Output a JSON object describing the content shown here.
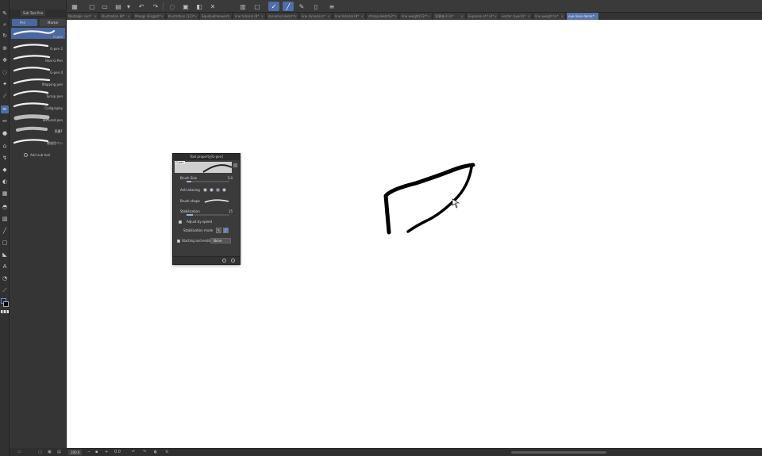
{
  "toolbar": {
    "icons": [
      "menu-icon",
      "new-file-icon",
      "open-icon",
      "save-icon",
      "dropdown-icon",
      "undo-icon",
      "redo-icon",
      "lasso-icon",
      "transform-icon",
      "fill-icon",
      "clear-icon",
      "pen-mode-icon",
      "line-mode-icon",
      "edit-icon",
      "layer-icon",
      "document-icon"
    ]
  },
  "tabs": [
    {
      "label": "Nostalgic con*"
    },
    {
      "label": "Illustration (8*"
    },
    {
      "label": "Manga (Eng(ph*"
    },
    {
      "label": "Illustration (12)*"
    },
    {
      "label": "Squiduelheaven*"
    },
    {
      "label": "line tutorial (9*"
    },
    {
      "label": "dynamic(sketch*"
    },
    {
      "label": "line dynamics*"
    },
    {
      "label": "line tutorial (9*"
    },
    {
      "label": "strong sketch(2*"
    },
    {
      "label": "line weight(12)*"
    },
    {
      "label": "見事来子(3)*"
    },
    {
      "label": "Expanse of f (2*"
    },
    {
      "label": "vector layer(5*"
    },
    {
      "label": "line weight tu*"
    },
    {
      "label": "eye lines demo*",
      "active": true
    }
  ],
  "subtool": {
    "header_title": "Sub Tool Pen",
    "tab_pen": "Pen",
    "tab_marker": "Marker",
    "brushes": [
      {
        "label": "G-pen",
        "selected": true
      },
      {
        "label": "G-pen 2"
      },
      {
        "label": "Real G-Pen"
      },
      {
        "label": "G-pen 4"
      },
      {
        "label": "Mapping pen"
      },
      {
        "label": "Turnip pen"
      },
      {
        "label": "Calligraphy"
      },
      {
        "label": "Textured pen"
      },
      {
        "label": "筋書F"
      },
      {
        "label": "線描用ペン"
      }
    ],
    "add_label": "Add sub tool"
  },
  "tool_property": {
    "title": "Tool property[G-pen]",
    "preview_name": "G-pen",
    "brush_size_label": "Brush Size",
    "brush_size_value": "3.0",
    "brush_size_fraction": 0.12,
    "anti_aliasing_label": "Anti-aliasing",
    "anti_aliasing_level": 3,
    "brush_shape_label": "Brush shape",
    "stabilization_label": "Stabilization",
    "stabilization_value": "15",
    "stabilization_fraction": 0.15,
    "adjust_by_speed_label": "Adjust by speed",
    "adjust_by_speed_checked": true,
    "stabilization_mode_label": "Stabilization mode",
    "starting_ending_label": "Starting and ending",
    "starting_ending_value": "None"
  },
  "status": {
    "zoom": "100.0",
    "rotation": "0.0"
  },
  "colors": {
    "main_color": "#0a2a6a",
    "sub_color": "#000000",
    "accent": "#4d6ea8"
  }
}
